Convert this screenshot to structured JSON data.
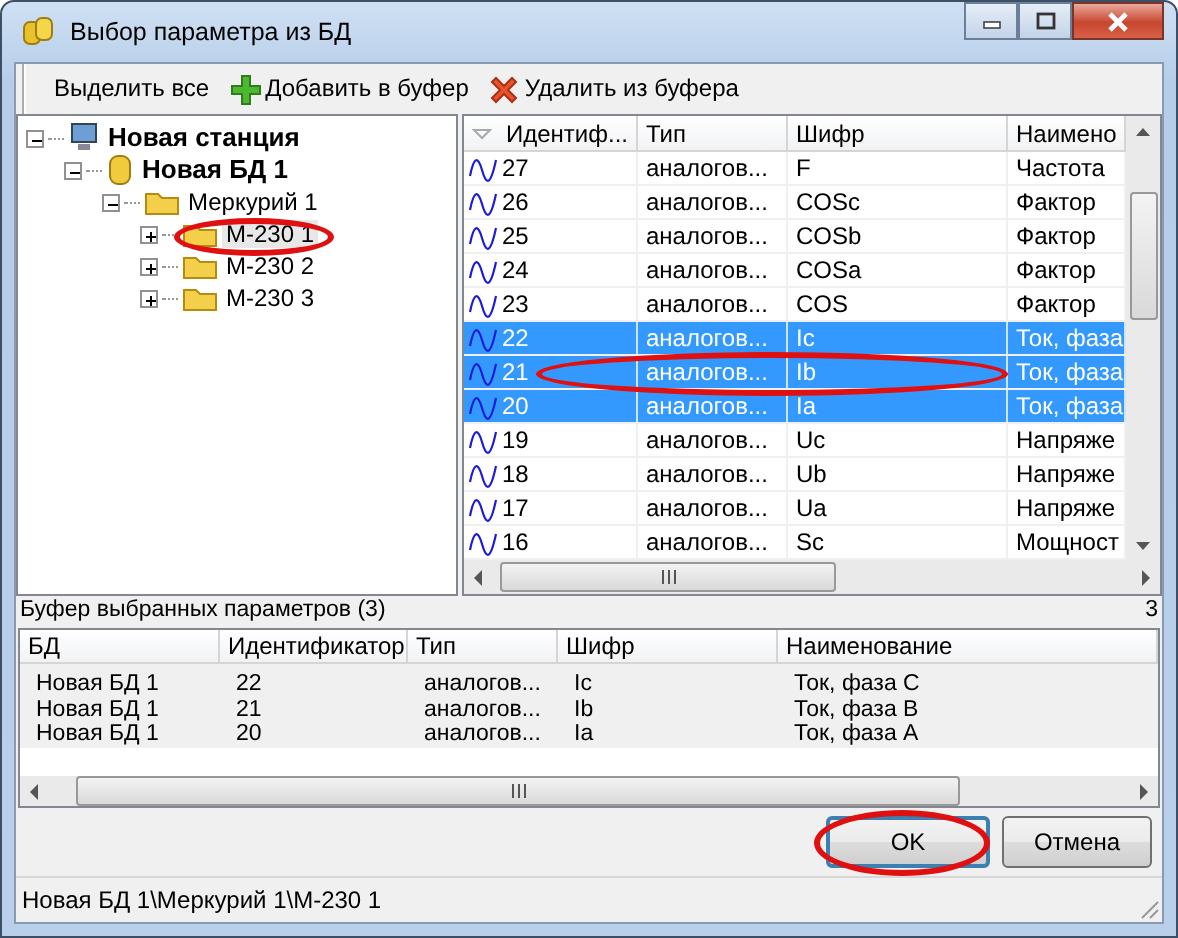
{
  "window": {
    "title": "Выбор параметра из БД"
  },
  "toolbar": [
    {
      "label": "Выделить все",
      "kind": "plain"
    },
    {
      "label": "Добавить в буфер",
      "kind": "add"
    },
    {
      "label": "Удалить из буфера",
      "kind": "remove"
    }
  ],
  "tree": [
    {
      "label": "Новая станция",
      "kind": "station",
      "expanded": true,
      "selected": false,
      "children": [
        {
          "label": "Новая БД 1",
          "kind": "database",
          "expanded": true,
          "selected": false,
          "children": [
            {
              "label": "Меркурий 1",
              "kind": "folder",
              "expanded": true,
              "selected": false,
              "children": [
                {
                  "label": "М-230 1",
                  "kind": "folder",
                  "expanded": false,
                  "selected": true
                },
                {
                  "label": "М-230 2",
                  "kind": "folder",
                  "expanded": false,
                  "selected": false
                },
                {
                  "label": "М-230 3",
                  "kind": "folder",
                  "expanded": false,
                  "selected": false
                }
              ]
            }
          ]
        }
      ]
    }
  ],
  "grid": {
    "columns": [
      "Идентиф...",
      "Тип",
      "Шифр",
      "Наимено"
    ],
    "rows": [
      {
        "cells": [
          "27",
          "аналогов...",
          "F",
          "Частота"
        ],
        "selected": false
      },
      {
        "cells": [
          "26",
          "аналогов...",
          "COSc",
          "Фактор"
        ],
        "selected": false
      },
      {
        "cells": [
          "25",
          "аналогов...",
          "COSb",
          "Фактор"
        ],
        "selected": false
      },
      {
        "cells": [
          "24",
          "аналогов...",
          "COSa",
          "Фактор"
        ],
        "selected": false
      },
      {
        "cells": [
          "23",
          "аналогов...",
          "COS",
          "Фактор"
        ],
        "selected": false
      },
      {
        "cells": [
          "22",
          "аналогов...",
          "Ic",
          "Ток, фаза"
        ],
        "selected": true
      },
      {
        "cells": [
          "21",
          "аналогов...",
          "Ib",
          "Ток, фаза"
        ],
        "selected": true
      },
      {
        "cells": [
          "20",
          "аналогов...",
          "Ia",
          "Ток, фаза"
        ],
        "selected": true
      },
      {
        "cells": [
          "19",
          "аналогов...",
          "Uc",
          "Напряже"
        ],
        "selected": false
      },
      {
        "cells": [
          "18",
          "аналогов...",
          "Ub",
          "Напряже"
        ],
        "selected": false
      },
      {
        "cells": [
          "17",
          "аналогов...",
          "Ua",
          "Напряже"
        ],
        "selected": false
      },
      {
        "cells": [
          "16",
          "аналогов...",
          "Sc",
          "Мощност"
        ],
        "selected": false
      }
    ]
  },
  "buffer": {
    "title": "Буфер выбранных параметров (3)",
    "side_label": "3",
    "columns": [
      "БД",
      "Идентификатор",
      "Тип",
      "Шифр",
      "Наименование"
    ],
    "rows": [
      [
        "Новая БД 1",
        "22",
        "аналогов...",
        "Ic",
        "Ток, фаза C"
      ],
      [
        "Новая БД 1",
        "21",
        "аналогов...",
        "Ib",
        "Ток, фаза B"
      ],
      [
        "Новая БД 1",
        "20",
        "аналогов...",
        "Ia",
        "Ток, фаза A"
      ]
    ]
  },
  "buttons": [
    {
      "label": "OK",
      "kind": "default"
    },
    {
      "label": "Отмена",
      "kind": "normal"
    }
  ],
  "status_bar": "Новая БД 1\\Меркурий 1\\М-230 1"
}
